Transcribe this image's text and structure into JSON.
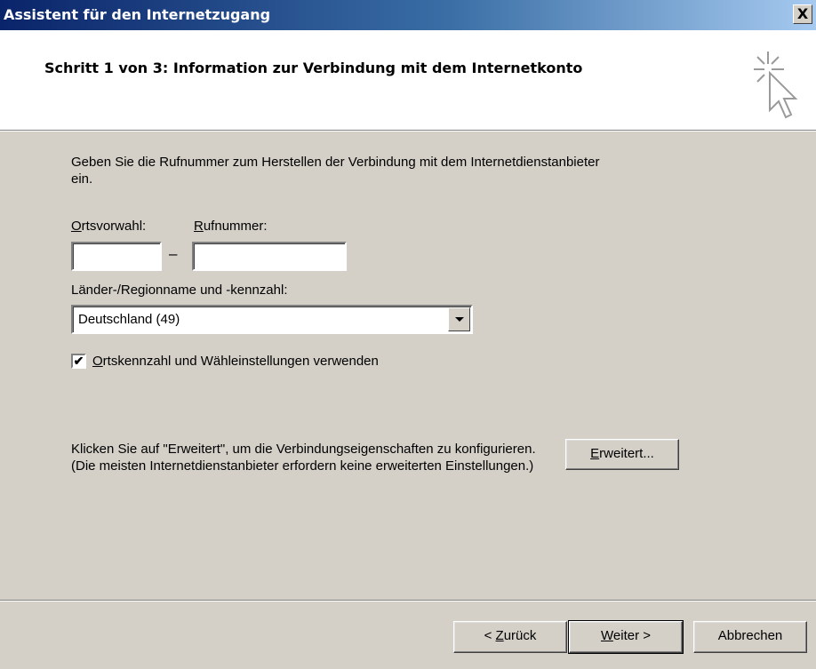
{
  "window": {
    "title": "Assistent für den Internetzugang",
    "close_label": "X"
  },
  "header": {
    "step_title": "Schritt 1 von 3: Information zur Verbindung mit dem Internetkonto"
  },
  "body": {
    "intro": "Geben Sie die Rufnummer zum Herstellen der Verbindung mit dem Internetdienstanbieter ein.",
    "area_label_mnemonic": "O",
    "area_label_rest": "rtsvorwahl:",
    "phone_label_mnemonic": "R",
    "phone_label_rest": "ufnummer:",
    "area_value": "",
    "phone_value": "",
    "dash": "–",
    "country_label": "Länder-/Regionname und -kennzahl:",
    "country_selected": "Deutschland (49)",
    "use_dial_rules_checked": true,
    "use_dial_rules_mnemonic": "O",
    "use_dial_rules_rest": "rtskennzahl und Wähleinstellungen verwenden",
    "advanced_text": "Klicken Sie auf \"Erweitert\", um die Verbindungseigenschaften zu konfigurieren.\n(Die meisten Internetdienstanbieter erfordern keine erweiterten Einstellungen.)",
    "advanced_button_mnemonic": "E",
    "advanced_button_rest": "rweitert..."
  },
  "footer": {
    "back_prefix": "< ",
    "back_mnemonic": "Z",
    "back_rest": "urück",
    "next_mnemonic": "W",
    "next_rest": "eiter >",
    "cancel": "Abbrechen"
  }
}
